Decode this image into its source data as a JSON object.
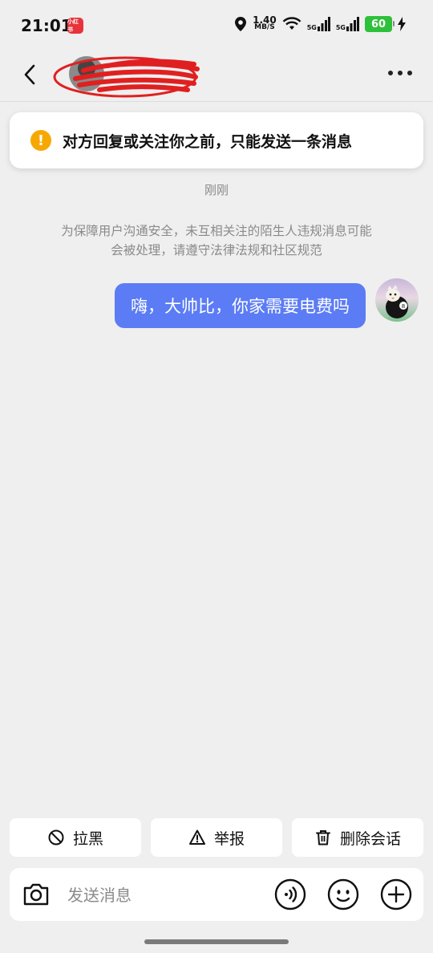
{
  "status_bar": {
    "time": "21:01",
    "app_badge": "小红书",
    "net_speed_value": "1.40",
    "net_speed_unit": "MB/S",
    "signal_1": "5G",
    "signal_2": "5G",
    "battery": "60"
  },
  "header": {
    "contact_name": "",
    "more_icon": "more-dots-icon"
  },
  "notice": {
    "icon": "warning-icon",
    "text": "对方回复或关注你之前，只能发送一条消息"
  },
  "chat": {
    "timestamp": "刚刚",
    "system_note": "为保障用户沟通安全，未互相关注的陌生人违规消息可能会被处理，请遵守法律法规和社区规范",
    "messages": [
      {
        "sender": "me",
        "text": "嗨，大帅比，你家需要电费吗"
      }
    ]
  },
  "actions": {
    "block_label": "拉黑",
    "report_label": "举报",
    "delete_label": "删除会话"
  },
  "input_bar": {
    "placeholder": "发送消息",
    "value": ""
  },
  "colors": {
    "bubble": "#5b7cf4",
    "warning": "#f6a800",
    "background": "#efefef"
  }
}
